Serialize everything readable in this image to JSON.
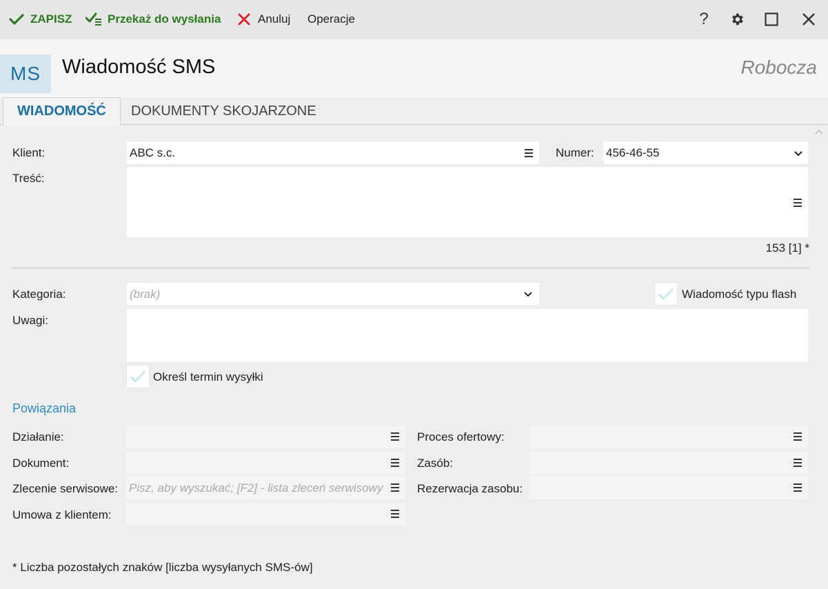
{
  "toolbar": {
    "save_label": "ZAPISZ",
    "send_label": "Przekaż do wysłania",
    "cancel_label": "Anuluj",
    "operations_label": "Operacje",
    "help_label": "?",
    "colors": {
      "green": "#2c7a1f",
      "red": "#d9262b"
    }
  },
  "header": {
    "badge": "MS",
    "title": "Wiadomość SMS",
    "status": "Robocza"
  },
  "tabs": [
    {
      "label": "WIADOMOŚĆ",
      "active": true
    },
    {
      "label": "DOKUMENTY SKOJARZONE",
      "active": false
    }
  ],
  "form": {
    "client_label": "Klient:",
    "client_value": "ABC s.c.",
    "number_label": "Numer:",
    "number_value": "456-46-55",
    "content_label": "Treść:",
    "content_value": "",
    "counter": "153 [1] *",
    "category_label": "Kategoria:",
    "category_placeholder": "(brak)",
    "flash_label": "Wiadomość typu flash",
    "flash_checked": false,
    "notes_label": "Uwagi:",
    "notes_value": "",
    "schedule_label": "Określ termin wysyłki",
    "schedule_checked": false
  },
  "relations": {
    "title": "Powiązania",
    "action_label": "Działanie:",
    "document_label": "Dokument:",
    "service_order_label": "Zlecenie serwisowe:",
    "service_order_placeholder": "Pisz, aby wyszukać; [F2] - lista zleceń serwisowy",
    "contract_label": "Umowa z klientem:",
    "offer_process_label": "Proces ofertowy:",
    "resource_label": "Zasób:",
    "resource_reservation_label": "Rezerwacja zasobu:"
  },
  "footnote": "* Liczba pozostałych znaków [liczba wysyłanych SMS-ów]"
}
